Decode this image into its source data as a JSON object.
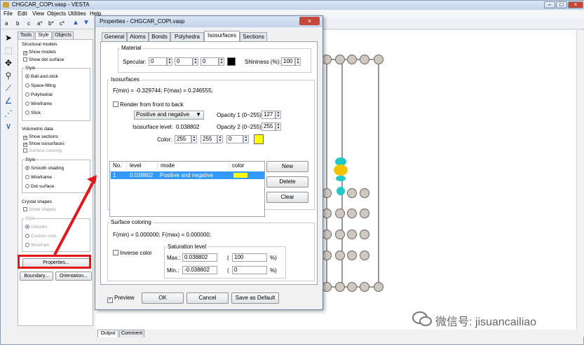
{
  "main": {
    "title": "CHGCAR_COPt.vasp - VESTA",
    "menu": [
      "File",
      "Edit",
      "View",
      "Objects",
      "Utilities",
      "Help"
    ],
    "toolbar": [
      "a",
      "b",
      "c",
      "a*",
      "b*",
      "c*"
    ]
  },
  "left": {
    "tabs": [
      "Tools",
      "Style",
      "Objects"
    ],
    "structural": {
      "title": "Structural models",
      "show_models": "Show models",
      "show_dot": "Show dot surface",
      "style_title": "Style",
      "styles": [
        "Ball-and-stick",
        "Space-filling",
        "Polyhedral",
        "Wireframe",
        "Stick"
      ]
    },
    "volumetric": {
      "title": "Volumetric data",
      "show_sections": "Show sections",
      "show_iso": "Show isosurfaces",
      "surface_coloring": "Surface coloring",
      "style_title": "Style",
      "styles": [
        "Smooth shading",
        "Wireframe",
        "Dot surface"
      ]
    },
    "crystal": {
      "title": "Crystal shapes",
      "show_shapes": "Show shapes",
      "style_title": "Style",
      "styles": [
        "Unicolor",
        "Custom colo",
        "Wirefram"
      ]
    },
    "properties_btn": "Properties...",
    "boundary_btn": "Boundary...",
    "orientation_btn": "Orientation..."
  },
  "bottom_tabs": [
    "Output",
    "Comment"
  ],
  "dialog": {
    "title": "Properties - CHGCAR_COPt.vasp",
    "tabs": [
      "General",
      "Atoms",
      "Bonds",
      "Polyhedra",
      "Isosurfaces",
      "Sections"
    ],
    "material": {
      "title": "Material",
      "specular_label": "Specular:",
      "specular": [
        "0",
        "0",
        "0"
      ],
      "shininess_label": "Shininess (%):",
      "shininess": "100",
      "color": "#000000"
    },
    "iso": {
      "title": "Isosurfaces",
      "fmin_fmax": "F(min) = -0.329744;   F(max) = 0.246555;",
      "render_label": "Render from front to back",
      "mode_select": "Positive and negative",
      "opacity1_label": "Opacity 1 (0~255):",
      "opacity1": "127",
      "opacity2_label": "Opacity 2 (0~255):",
      "opacity2": "255",
      "level_label": "Isosurface level:",
      "level": "0.038802",
      "color_label": "Color:",
      "color": [
        "255",
        "255",
        "0"
      ],
      "color_hex": "#ffff00",
      "columns": [
        "No.",
        "level",
        "mode",
        "color"
      ],
      "rows": [
        {
          "no": "1",
          "level": "0.038802",
          "mode": "Positive and negative"
        }
      ],
      "new_btn": "New",
      "delete_btn": "Delete",
      "clear_btn": "Clear"
    },
    "surf": {
      "title": "Surface coloring",
      "fmin_fmax": "F(min) = 0.000000;   F(max) = 0.000000;",
      "inverse_label": "Inverse color",
      "sat_title": "Saturation level",
      "max_label": "Max.:",
      "max": "0.038802",
      "max_pct": "100",
      "min_label": "Min.:",
      "min": "-0.038802",
      "min_pct": "0",
      "paren": "(",
      "pct": "%)"
    },
    "preview": "Preview",
    "ok": "OK",
    "cancel": "Cancel",
    "save_default": "Save as Default"
  },
  "watermark": "微信号: jisuancailiao"
}
